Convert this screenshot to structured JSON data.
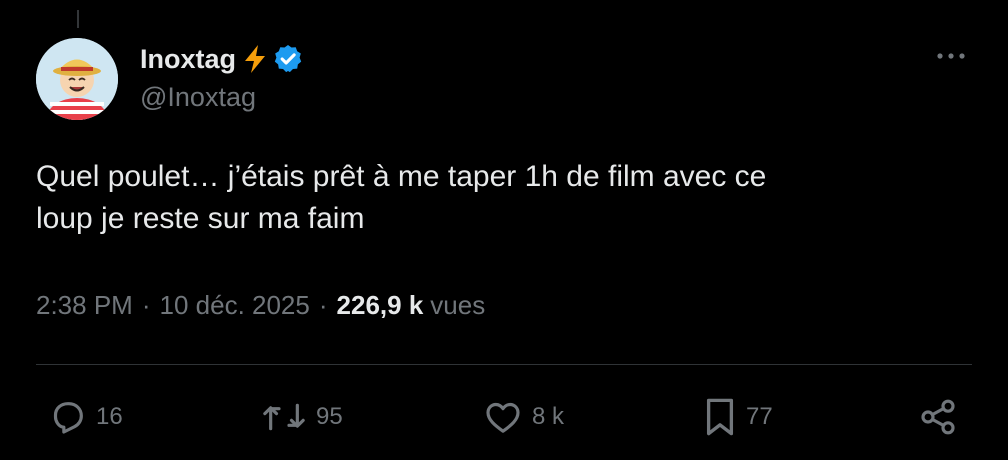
{
  "tweet": {
    "author": {
      "display_name": "Inoxtag",
      "handle": "@Inoxtag",
      "emoji_icon": "lightning-bolt-icon",
      "verified_icon": "verified-badge-icon"
    },
    "text_lines": [
      "Quel poulet… j’étais prêt à me taper 1h de film avec ce",
      "loup je reste sur ma faim"
    ],
    "meta": {
      "time": "2:38 PM",
      "separator": "·",
      "date": "10 déc. 2025",
      "views_count": "226,9 k",
      "views_label": "vues"
    },
    "actions": {
      "reply_count": "16",
      "retweet_count": "95",
      "like_count": "8 k",
      "bookmark_count": "77"
    }
  },
  "colors": {
    "background": "#000000",
    "text_primary": "#e7e9ea",
    "text_secondary": "#71767b",
    "verified_blue": "#1d9bf0",
    "bolt_orange": "#f59e0b",
    "divider": "#2f3336"
  }
}
